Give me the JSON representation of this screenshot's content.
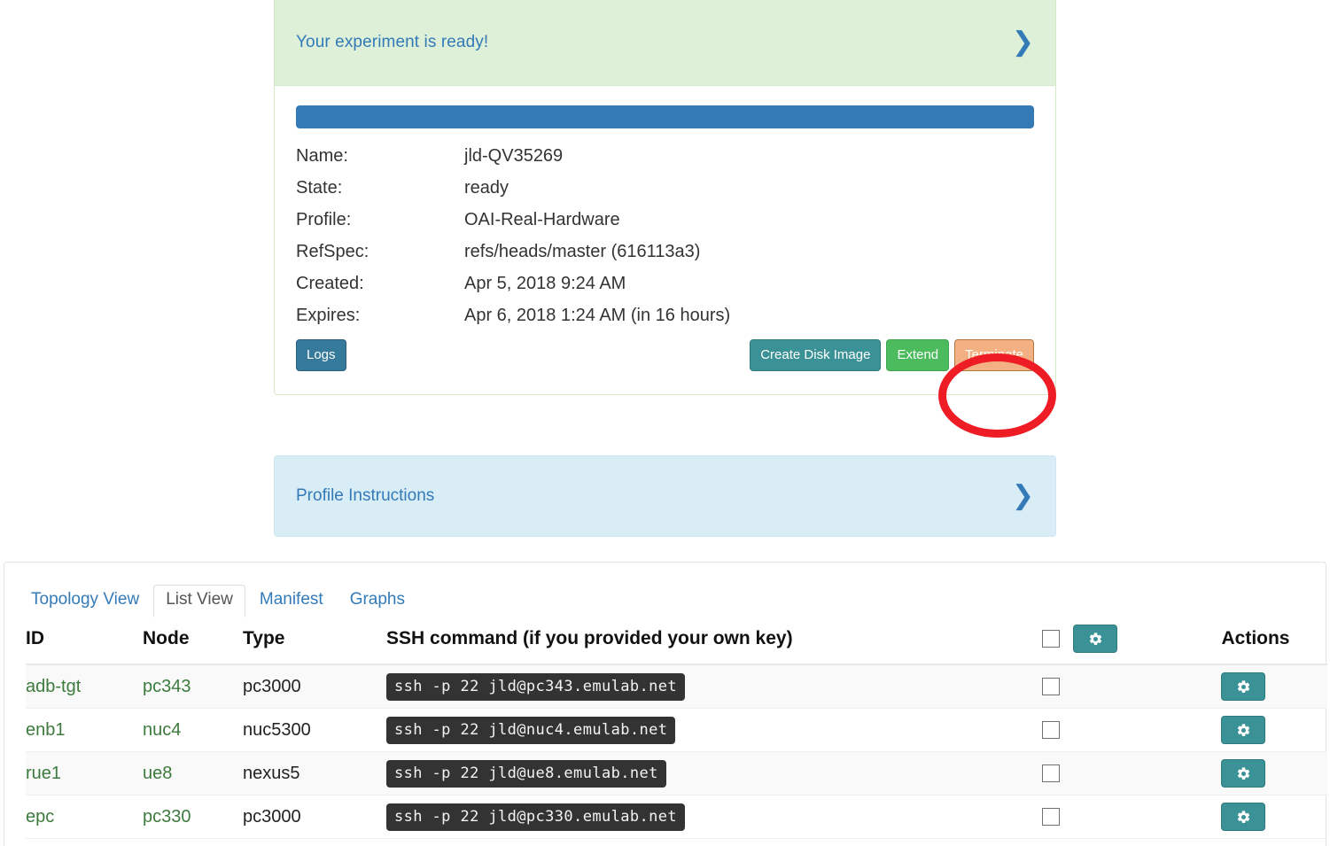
{
  "experiment_panel": {
    "header_title": "Your experiment is ready!",
    "expand_icon": "chevron-right-icon",
    "progress_percent": 100,
    "details": [
      {
        "key": "Name:",
        "value": "jld-QV35269",
        "style": "plain"
      },
      {
        "key": "State:",
        "value": "ready",
        "style": "ready"
      },
      {
        "key": "Profile:",
        "value": "OAI-Real-Hardware",
        "style": "link"
      },
      {
        "key": "RefSpec:",
        "value": "refs/heads/master (616113a3)",
        "style": "plain"
      },
      {
        "key": "Created:",
        "value": "Apr 5, 2018 9:24 AM",
        "style": "plain"
      },
      {
        "key": "Expires:",
        "value": "Apr 6, 2018 1:24 AM (in 16 hours)",
        "style": "plain"
      }
    ],
    "buttons": {
      "logs": "Logs",
      "create_disk_image": "Create Disk Image",
      "extend": "Extend",
      "terminate": "Terminate"
    }
  },
  "profile_instructions": {
    "title": "Profile Instructions",
    "expand_icon": "chevron-right-icon"
  },
  "annotation": {
    "shape": "red-ellipse-highlight",
    "target": "Terminate",
    "color": "#ee1c25"
  },
  "list_panel": {
    "tabs": [
      {
        "label": "Topology View",
        "active": false
      },
      {
        "label": "List View",
        "active": true
      },
      {
        "label": "Manifest",
        "active": false
      },
      {
        "label": "Graphs",
        "active": false
      }
    ],
    "table": {
      "headers": {
        "id": "ID",
        "node": "Node",
        "type": "Type",
        "ssh": "SSH command",
        "ssh_note": "(if you provided your own key)",
        "select_all_icon": "checkbox-unchecked-icon",
        "header_gear_icon": "gear-icon",
        "actions": "Actions"
      },
      "rows": [
        {
          "id": "adb-tgt",
          "node": "pc343",
          "type": "pc3000",
          "ssh": "ssh -p 22 jld@pc343.emulab.net",
          "checked": false,
          "action_icon": "gear-icon"
        },
        {
          "id": "enb1",
          "node": "nuc4",
          "type": "nuc5300",
          "ssh": "ssh -p 22 jld@nuc4.emulab.net",
          "checked": false,
          "action_icon": "gear-icon"
        },
        {
          "id": "rue1",
          "node": "ue8",
          "type": "nexus5",
          "ssh": "ssh -p 22 jld@ue8.emulab.net",
          "checked": false,
          "action_icon": "gear-icon"
        },
        {
          "id": "epc",
          "node": "pc330",
          "type": "pc3000",
          "ssh": "ssh -p 22 jld@pc330.emulab.net",
          "checked": false,
          "action_icon": "gear-icon"
        }
      ]
    }
  },
  "colors": {
    "alert_success_bg": "#dff0d8",
    "alert_info_bg": "#d9edf7",
    "link_blue": "#337ab7",
    "state_green": "#17a000",
    "teal_button": "#3a9296",
    "green_button": "#4cbb5e",
    "terminate_button": "#f3b183",
    "annotation_red": "#ee1c25",
    "progress_blue": "#337ab7"
  }
}
